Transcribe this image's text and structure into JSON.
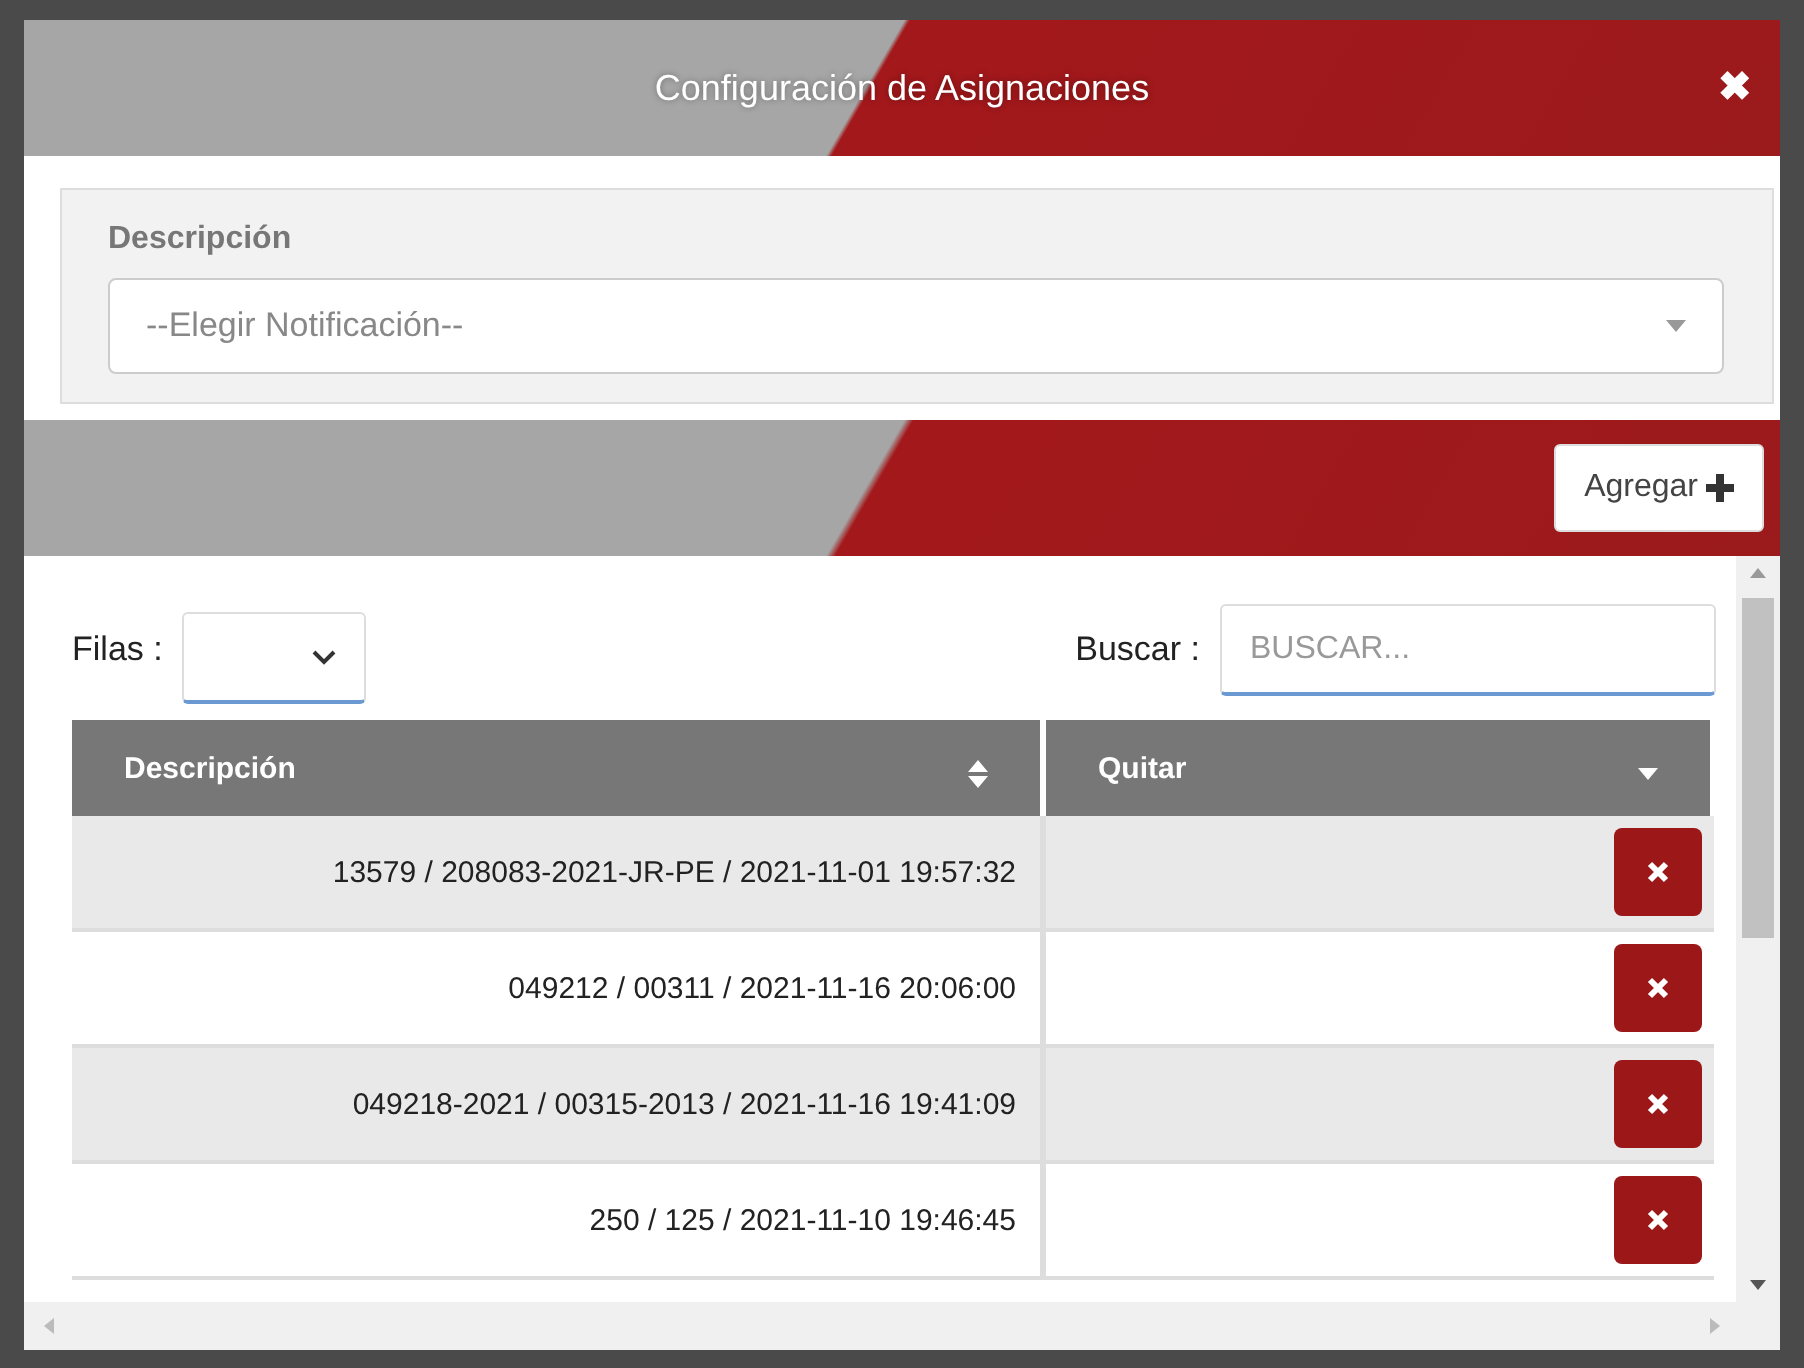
{
  "window": {
    "title": "Configuración de Asignaciones",
    "close": "✖"
  },
  "form": {
    "label": "Descripción",
    "placeholder": "--Elegir Notificación--"
  },
  "add_button": {
    "label": "Agregar"
  },
  "rows_control": {
    "label": "Filas :"
  },
  "search": {
    "label": "Buscar :",
    "placeholder": "BUSCAR..."
  },
  "table": {
    "columns": [
      {
        "label": "Descripción",
        "kind": "sortable"
      },
      {
        "label": "Quitar",
        "kind": "sorted"
      }
    ],
    "rows": [
      {
        "description": "13579 / 208083-2021-JR-PE / 2021-11-01 19:57:32"
      },
      {
        "description": "049212 / 00311 / 2021-11-16 20:06:00"
      },
      {
        "description": "049218-2021 / 00315-2013 / 2021-11-16 19:41:09"
      },
      {
        "description": "250 / 125 / 2021-11-10 19:46:45"
      }
    ]
  }
}
